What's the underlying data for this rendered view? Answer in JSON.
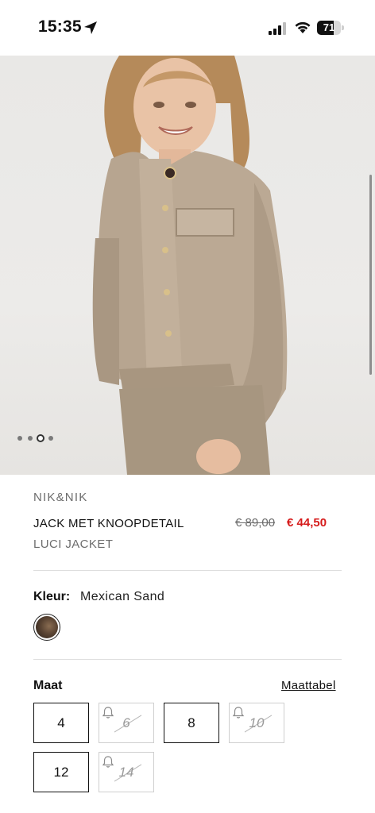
{
  "status_bar": {
    "time": "15:35",
    "battery_level": "71",
    "battery_fraction": 0.71
  },
  "product": {
    "brand": "NIK&NIK",
    "name": "JACK MET KNOOPDETAIL",
    "subtitle": "LUCI JACKET",
    "old_price": "€ 89,00",
    "new_price": "€ 44,50",
    "image_count": 4,
    "active_image_index": 2
  },
  "color": {
    "label": "Kleur:",
    "value": "Mexican Sand"
  },
  "size": {
    "label": "Maat",
    "chart_link": "Maattabel",
    "options": [
      {
        "label": "4",
        "available": true
      },
      {
        "label": "6",
        "available": false
      },
      {
        "label": "8",
        "available": true
      },
      {
        "label": "10",
        "available": false
      },
      {
        "label": "12",
        "available": true
      },
      {
        "label": "14",
        "available": false
      }
    ]
  },
  "colors": {
    "sale_price": "#d61c1c",
    "text": "#111111",
    "muted": "#6d6d6d"
  }
}
